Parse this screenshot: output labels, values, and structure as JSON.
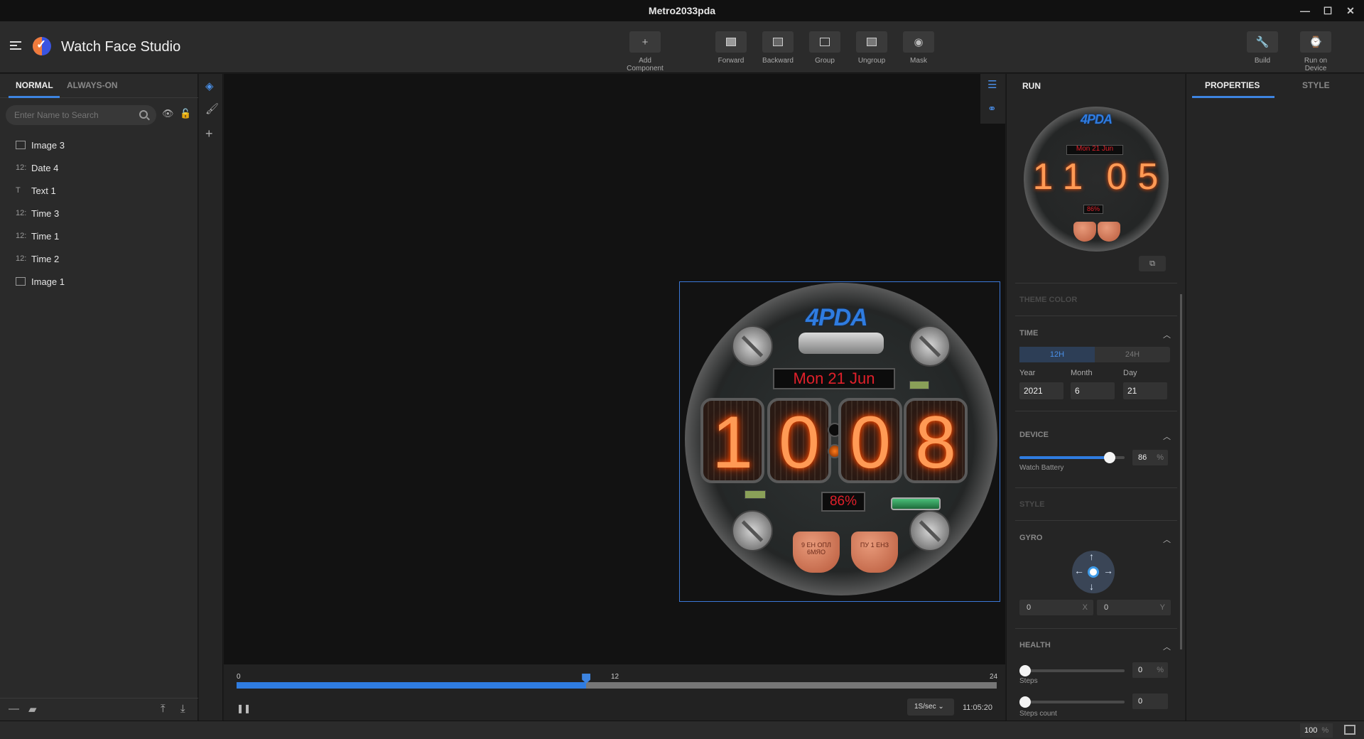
{
  "window": {
    "title": "Metro2033pda",
    "minimize": "—",
    "maximize": "☐",
    "close": "✕"
  },
  "app": {
    "name": "Watch Face Studio"
  },
  "toolbar": {
    "add_component": "Add Component",
    "forward": "Forward",
    "backward": "Backward",
    "group": "Group",
    "ungroup": "Ungroup",
    "mask": "Mask",
    "build": "Build",
    "run_on_device": "Run on Device"
  },
  "left_panel": {
    "tabs": [
      "NORMAL",
      "ALWAYS-ON"
    ],
    "search_placeholder": "Enter Name to Search",
    "layers": [
      {
        "icon": "image-icon",
        "label": "Image 3"
      },
      {
        "icon": "date-icon",
        "prefix": "12:",
        "label": "Date 4"
      },
      {
        "icon": "text-icon",
        "prefix": "T",
        "label": "Text 1"
      },
      {
        "icon": "time-icon",
        "prefix": "12:",
        "label": "Time 3"
      },
      {
        "icon": "time-icon",
        "prefix": "12:",
        "label": "Time 1"
      },
      {
        "icon": "time-icon",
        "prefix": "12:",
        "label": "Time 2"
      },
      {
        "icon": "image-icon",
        "label": "Image 1"
      }
    ]
  },
  "watch": {
    "brand": "4PDA",
    "date": "Mon 21 Jun",
    "digits": [
      "1",
      "0",
      "0",
      "8"
    ],
    "battery": "86%",
    "cap_left_text": "9 ЕН ОПЛ 6МЯО",
    "cap_right_text": "ПУ 1 ЕНЗ"
  },
  "timeline": {
    "start": "0",
    "mid": "12",
    "end": "24",
    "progress": 0.46,
    "speed": "1S/sec",
    "time": "11:05:20"
  },
  "run": {
    "title": "RUN",
    "preview": {
      "brand": "4PDA",
      "date": "Mon 21 Jun",
      "digits": [
        "1",
        "1",
        "0",
        "5"
      ],
      "battery": "86%"
    },
    "theme_color": "THEME COLOR",
    "time_section": "TIME",
    "time_formats": [
      "12H",
      "24H"
    ],
    "year_label": "Year",
    "year": "2021",
    "month_label": "Month",
    "month": "6",
    "day_label": "Day",
    "day": "21",
    "device_section": "DEVICE",
    "watch_battery_label": "Watch Battery",
    "watch_battery": "86",
    "watch_battery_level": 0.86,
    "percent": "%",
    "style_section": "STYLE",
    "gyro_section": "GYRO",
    "gyro_x": "0",
    "gyro_x_label": "X",
    "gyro_y": "0",
    "gyro_y_label": "Y",
    "health_section": "HEALTH",
    "steps_label": "Steps",
    "steps": "0",
    "steps_count_label": "Steps count",
    "steps_count": "0"
  },
  "properties": {
    "tabs": [
      "PROPERTIES",
      "STYLE"
    ]
  },
  "status": {
    "zoom": "100",
    "zoom_unit": "%"
  },
  "colors": {
    "accent": "#3d84e0",
    "nixie": "#ff9a55",
    "led_red": "#e0202a"
  }
}
